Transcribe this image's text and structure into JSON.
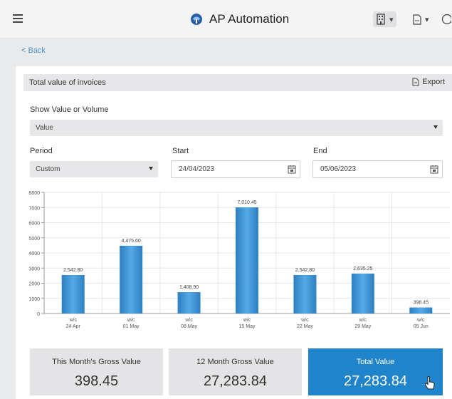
{
  "header": {
    "title": "AP Automation",
    "menu_icon": "hamburger-icon",
    "logo_icon": "app-logo-icon",
    "toolbar_icons": [
      "building-icon",
      "document-icon",
      "help-icon"
    ]
  },
  "nav": {
    "back_label": "< Back"
  },
  "panel": {
    "title": "Total value of invoices",
    "export_label": "Export"
  },
  "filters": {
    "show_label": "Show Value or Volume",
    "show_value": "Value",
    "period_label": "Period",
    "period_value": "Custom",
    "start_label": "Start",
    "start_value": "24/04/2023",
    "end_label": "End",
    "end_value": "05/06/2023"
  },
  "chart_data": {
    "type": "bar",
    "categories": [
      [
        "w/c",
        "24 Apr"
      ],
      [
        "w/c",
        "01 May"
      ],
      [
        "w/c",
        "08 May"
      ],
      [
        "w/c",
        "15 May"
      ],
      [
        "w/c",
        "22 May"
      ],
      [
        "w/c",
        "29 May"
      ],
      [
        "w/c",
        "05 Jun"
      ]
    ],
    "values": [
      2542.8,
      4475.6,
      1408.9,
      7010.45,
      2542.8,
      2635.25,
      398.45
    ],
    "value_labels": [
      "2,542.80",
      "4,475.60",
      "1,408.90",
      "7,010.45",
      "2,542.80",
      "2,635.25",
      "398.45"
    ],
    "yticks": [
      0,
      1000,
      2000,
      3000,
      4000,
      5000,
      6000,
      7000,
      8000
    ],
    "ylim": [
      0,
      8000
    ],
    "grid": true,
    "bar_color": "#3d93d4"
  },
  "stats": [
    {
      "label": "This Month's Gross Value",
      "value": "398.45"
    },
    {
      "label": "12 Month Gross Value",
      "value": "27,283.84"
    },
    {
      "label": "Total Value",
      "value": "27,283.84"
    }
  ],
  "colors": {
    "accent": "#1f84c9",
    "link": "#4a90c8"
  }
}
